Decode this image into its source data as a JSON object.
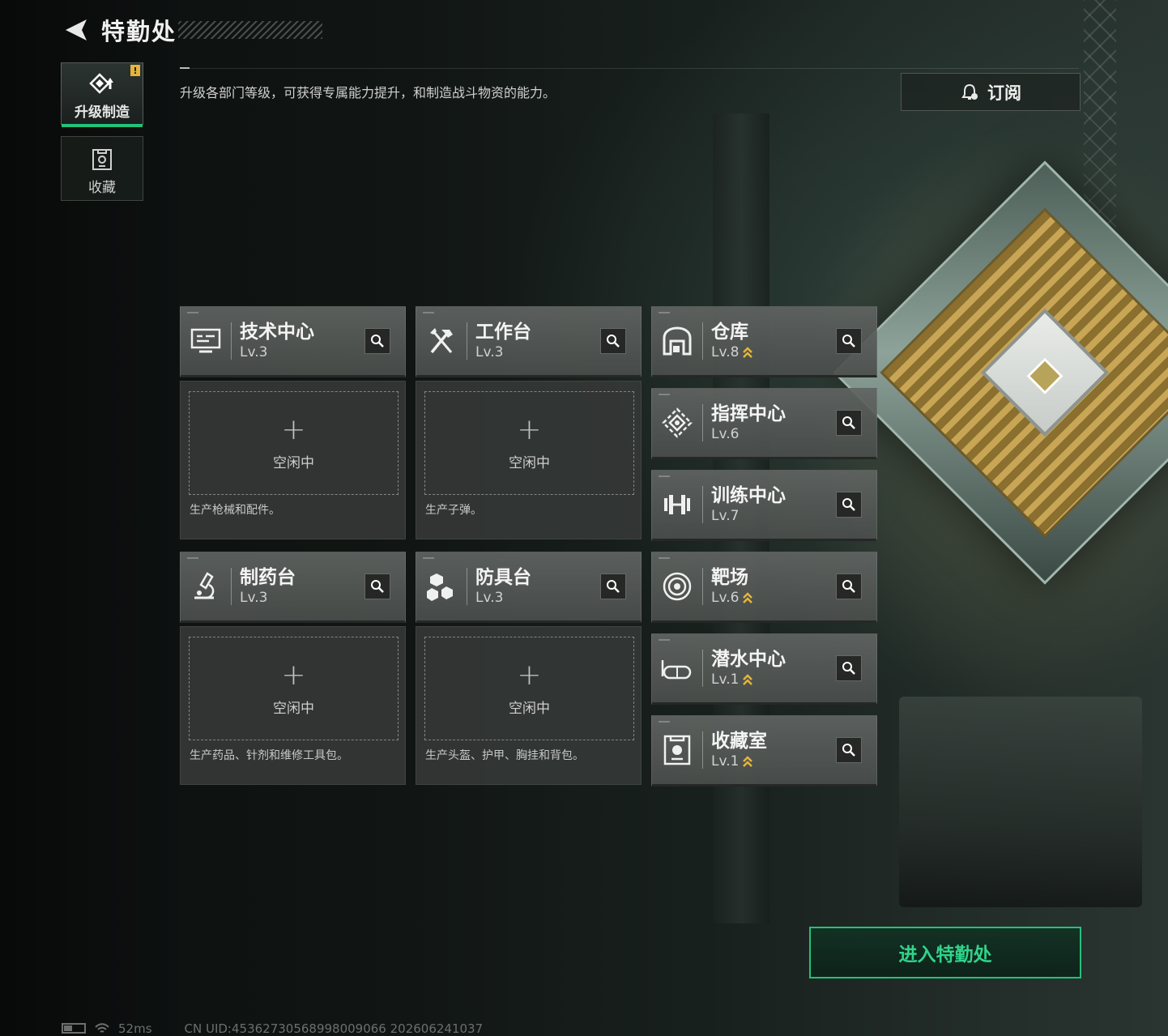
{
  "header": {
    "title": "特勤处"
  },
  "tabs": [
    {
      "label": "升级制造",
      "active": true,
      "badge": "!",
      "icon": "upgrade-icon"
    },
    {
      "label": "收藏",
      "active": false,
      "icon": "collection-icon"
    }
  ],
  "description": "升级各部门等级，可获得专属能力提升，和制造战斗物资的能力。",
  "subscribe": {
    "label": "订阅",
    "icon": "bell-icon"
  },
  "production": [
    {
      "name": "技术中心",
      "level": "Lv.3",
      "icon": "monitor-icon",
      "slot_label": "空闲中",
      "slot_plus": "+",
      "slot_desc": "生产枪械和配件。"
    },
    {
      "name": "工作台",
      "level": "Lv.3",
      "icon": "tools-icon",
      "slot_label": "空闲中",
      "slot_plus": "+",
      "slot_desc": "生产子弹。"
    },
    {
      "name": "制药台",
      "level": "Lv.3",
      "icon": "microscope-icon",
      "slot_label": "空闲中",
      "slot_plus": "+",
      "slot_desc": "生产药品、针剂和维修工具包。"
    },
    {
      "name": "防具台",
      "level": "Lv.3",
      "icon": "armor-icon",
      "slot_label": "空闲中",
      "slot_plus": "+",
      "slot_desc": "生产头盔、护甲、胸挂和背包。"
    }
  ],
  "facilities": [
    {
      "name": "仓库",
      "level": "Lv.8",
      "upgradable": true,
      "icon": "warehouse-icon"
    },
    {
      "name": "指挥中心",
      "level": "Lv.6",
      "upgradable": false,
      "icon": "command-icon"
    },
    {
      "name": "训练中心",
      "level": "Lv.7",
      "upgradable": false,
      "icon": "dumbbell-icon"
    },
    {
      "name": "靶场",
      "level": "Lv.6",
      "upgradable": true,
      "icon": "target-icon"
    },
    {
      "name": "潜水中心",
      "level": "Lv.1",
      "upgradable": true,
      "icon": "goggles-icon"
    },
    {
      "name": "收藏室",
      "level": "Lv.1",
      "upgradable": true,
      "icon": "trophy-icon"
    }
  ],
  "enter_button": "进入特勤处",
  "status": {
    "ping": "52ms",
    "uid": "CN UID:45362730568998009066 202606241037"
  },
  "colors": {
    "accent": "#22c27a",
    "upgrade": "#e5b53b"
  }
}
